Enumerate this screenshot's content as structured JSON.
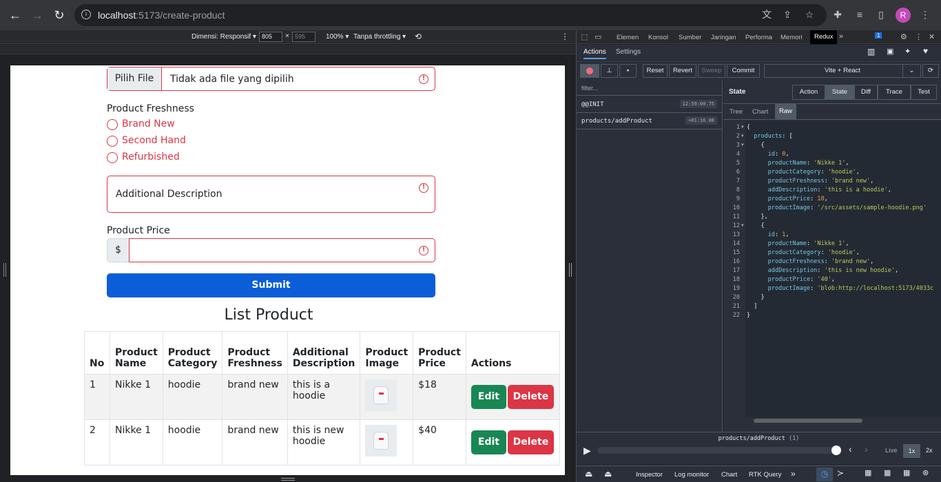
{
  "browser": {
    "url_host": "localhost",
    "url_path": ":5173/create-product",
    "avatar_letter": "R"
  },
  "device_toolbar": {
    "dimension_label": "Dimensi: Responsif ▾",
    "width": "805",
    "height": "595",
    "zoom": "100% ▾",
    "throttling": "Tanpa throttling ▾"
  },
  "form": {
    "file_button": "Pilih File",
    "file_status": "Tidak ada file yang dipilih",
    "freshness_label": "Product Freshness",
    "freshness_options": [
      "Brand New",
      "Second Hand",
      "Refurbished"
    ],
    "description_placeholder": "Additional Description",
    "price_label": "Product Price",
    "currency_symbol": "$",
    "submit_label": "Submit"
  },
  "list": {
    "title": "List Product",
    "headers": [
      "No",
      "Product Name",
      "Product Category",
      "Product Freshness",
      "Additional Description",
      "Product Image",
      "Product Price",
      "Actions"
    ],
    "rows": [
      {
        "no": "1",
        "name": "Nikke 1",
        "category": "hoodie",
        "freshness": "brand new",
        "description": "this is a hoodie",
        "price": "$18"
      },
      {
        "no": "2",
        "name": "Nikke 1",
        "category": "hoodie",
        "freshness": "brand new",
        "description": "this is new hoodie",
        "price": "$40"
      }
    ],
    "edit_label": "Edit",
    "delete_label": "Delete"
  },
  "devtools": {
    "tabs": [
      "Elemen",
      "Konsol",
      "Sumber",
      "Jaringan",
      "Performa",
      "Memori",
      "Redux"
    ],
    "issues_count": "1",
    "redux": {
      "top_tabs": [
        "Actions",
        "Settings"
      ],
      "toolbar_buttons": [
        "Reset",
        "Revert",
        "Sweep",
        "Commit"
      ],
      "instance": "Vite + React",
      "filter_placeholder": "filter...",
      "actions": [
        {
          "name": "@@INIT",
          "time": "12:59:00.75"
        },
        {
          "name": "products/addProduct",
          "time": "+01:16.88"
        }
      ],
      "state_title": "State",
      "state_tabs": [
        "Action",
        "State",
        "Diff",
        "Trace",
        "Test"
      ],
      "view_tabs": [
        "Tree",
        "Chart",
        "Raw"
      ],
      "slider_label": "products/addProduct",
      "slider_count": "(1)",
      "live": "Live",
      "speed_1x": "1x",
      "speed_2x": "2x",
      "bottom_tabs": [
        "Inspector",
        "Log monitor",
        "Chart",
        "RTK Query"
      ]
    }
  }
}
